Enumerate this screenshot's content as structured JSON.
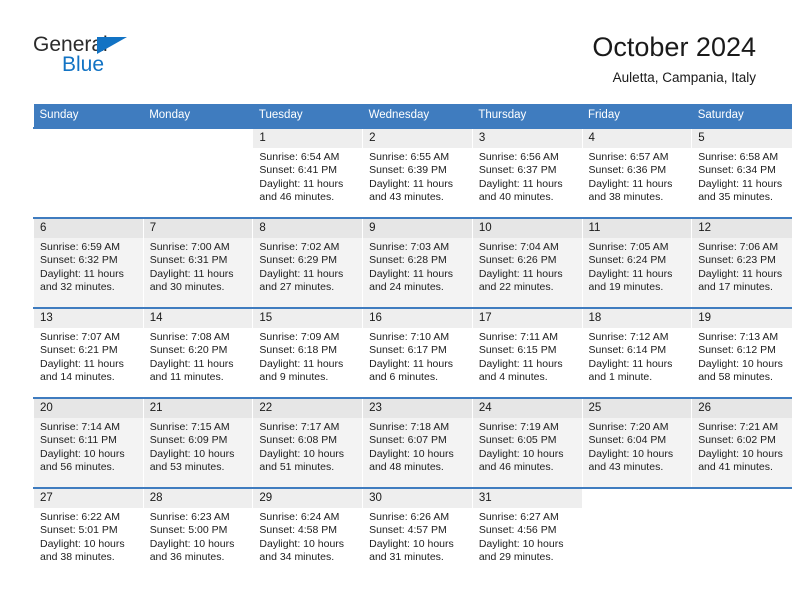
{
  "brand": {
    "name_part1": "General",
    "name_part2": "Blue",
    "accent_color": "#1273c4",
    "triangle_icon": "triangle-icon"
  },
  "header": {
    "title": "October 2024",
    "subtitle": "Auletta, Campania, Italy"
  },
  "calendar": {
    "header_bg": "#3f7cbf",
    "weekdays": [
      "Sunday",
      "Monday",
      "Tuesday",
      "Wednesday",
      "Thursday",
      "Friday",
      "Saturday"
    ],
    "labels": {
      "sunrise": "Sunrise:",
      "sunset": "Sunset:",
      "daylight": "Daylight:"
    },
    "weeks": [
      [
        {
          "day": "",
          "empty": true
        },
        {
          "day": "",
          "empty": true
        },
        {
          "day": "1",
          "sunrise": "Sunrise: 6:54 AM",
          "sunset": "Sunset: 6:41 PM",
          "daylight1": "Daylight: 11 hours",
          "daylight2": "and 46 minutes."
        },
        {
          "day": "2",
          "sunrise": "Sunrise: 6:55 AM",
          "sunset": "Sunset: 6:39 PM",
          "daylight1": "Daylight: 11 hours",
          "daylight2": "and 43 minutes."
        },
        {
          "day": "3",
          "sunrise": "Sunrise: 6:56 AM",
          "sunset": "Sunset: 6:37 PM",
          "daylight1": "Daylight: 11 hours",
          "daylight2": "and 40 minutes."
        },
        {
          "day": "4",
          "sunrise": "Sunrise: 6:57 AM",
          "sunset": "Sunset: 6:36 PM",
          "daylight1": "Daylight: 11 hours",
          "daylight2": "and 38 minutes."
        },
        {
          "day": "5",
          "sunrise": "Sunrise: 6:58 AM",
          "sunset": "Sunset: 6:34 PM",
          "daylight1": "Daylight: 11 hours",
          "daylight2": "and 35 minutes."
        }
      ],
      [
        {
          "day": "6",
          "sunrise": "Sunrise: 6:59 AM",
          "sunset": "Sunset: 6:32 PM",
          "daylight1": "Daylight: 11 hours",
          "daylight2": "and 32 minutes."
        },
        {
          "day": "7",
          "sunrise": "Sunrise: 7:00 AM",
          "sunset": "Sunset: 6:31 PM",
          "daylight1": "Daylight: 11 hours",
          "daylight2": "and 30 minutes."
        },
        {
          "day": "8",
          "sunrise": "Sunrise: 7:02 AM",
          "sunset": "Sunset: 6:29 PM",
          "daylight1": "Daylight: 11 hours",
          "daylight2": "and 27 minutes."
        },
        {
          "day": "9",
          "sunrise": "Sunrise: 7:03 AM",
          "sunset": "Sunset: 6:28 PM",
          "daylight1": "Daylight: 11 hours",
          "daylight2": "and 24 minutes."
        },
        {
          "day": "10",
          "sunrise": "Sunrise: 7:04 AM",
          "sunset": "Sunset: 6:26 PM",
          "daylight1": "Daylight: 11 hours",
          "daylight2": "and 22 minutes."
        },
        {
          "day": "11",
          "sunrise": "Sunrise: 7:05 AM",
          "sunset": "Sunset: 6:24 PM",
          "daylight1": "Daylight: 11 hours",
          "daylight2": "and 19 minutes."
        },
        {
          "day": "12",
          "sunrise": "Sunrise: 7:06 AM",
          "sunset": "Sunset: 6:23 PM",
          "daylight1": "Daylight: 11 hours",
          "daylight2": "and 17 minutes."
        }
      ],
      [
        {
          "day": "13",
          "sunrise": "Sunrise: 7:07 AM",
          "sunset": "Sunset: 6:21 PM",
          "daylight1": "Daylight: 11 hours",
          "daylight2": "and 14 minutes."
        },
        {
          "day": "14",
          "sunrise": "Sunrise: 7:08 AM",
          "sunset": "Sunset: 6:20 PM",
          "daylight1": "Daylight: 11 hours",
          "daylight2": "and 11 minutes."
        },
        {
          "day": "15",
          "sunrise": "Sunrise: 7:09 AM",
          "sunset": "Sunset: 6:18 PM",
          "daylight1": "Daylight: 11 hours",
          "daylight2": "and 9 minutes."
        },
        {
          "day": "16",
          "sunrise": "Sunrise: 7:10 AM",
          "sunset": "Sunset: 6:17 PM",
          "daylight1": "Daylight: 11 hours",
          "daylight2": "and 6 minutes."
        },
        {
          "day": "17",
          "sunrise": "Sunrise: 7:11 AM",
          "sunset": "Sunset: 6:15 PM",
          "daylight1": "Daylight: 11 hours",
          "daylight2": "and 4 minutes."
        },
        {
          "day": "18",
          "sunrise": "Sunrise: 7:12 AM",
          "sunset": "Sunset: 6:14 PM",
          "daylight1": "Daylight: 11 hours",
          "daylight2": "and 1 minute."
        },
        {
          "day": "19",
          "sunrise": "Sunrise: 7:13 AM",
          "sunset": "Sunset: 6:12 PM",
          "daylight1": "Daylight: 10 hours",
          "daylight2": "and 58 minutes."
        }
      ],
      [
        {
          "day": "20",
          "sunrise": "Sunrise: 7:14 AM",
          "sunset": "Sunset: 6:11 PM",
          "daylight1": "Daylight: 10 hours",
          "daylight2": "and 56 minutes."
        },
        {
          "day": "21",
          "sunrise": "Sunrise: 7:15 AM",
          "sunset": "Sunset: 6:09 PM",
          "daylight1": "Daylight: 10 hours",
          "daylight2": "and 53 minutes."
        },
        {
          "day": "22",
          "sunrise": "Sunrise: 7:17 AM",
          "sunset": "Sunset: 6:08 PM",
          "daylight1": "Daylight: 10 hours",
          "daylight2": "and 51 minutes."
        },
        {
          "day": "23",
          "sunrise": "Sunrise: 7:18 AM",
          "sunset": "Sunset: 6:07 PM",
          "daylight1": "Daylight: 10 hours",
          "daylight2": "and 48 minutes."
        },
        {
          "day": "24",
          "sunrise": "Sunrise: 7:19 AM",
          "sunset": "Sunset: 6:05 PM",
          "daylight1": "Daylight: 10 hours",
          "daylight2": "and 46 minutes."
        },
        {
          "day": "25",
          "sunrise": "Sunrise: 7:20 AM",
          "sunset": "Sunset: 6:04 PM",
          "daylight1": "Daylight: 10 hours",
          "daylight2": "and 43 minutes."
        },
        {
          "day": "26",
          "sunrise": "Sunrise: 7:21 AM",
          "sunset": "Sunset: 6:02 PM",
          "daylight1": "Daylight: 10 hours",
          "daylight2": "and 41 minutes."
        }
      ],
      [
        {
          "day": "27",
          "sunrise": "Sunrise: 6:22 AM",
          "sunset": "Sunset: 5:01 PM",
          "daylight1": "Daylight: 10 hours",
          "daylight2": "and 38 minutes."
        },
        {
          "day": "28",
          "sunrise": "Sunrise: 6:23 AM",
          "sunset": "Sunset: 5:00 PM",
          "daylight1": "Daylight: 10 hours",
          "daylight2": "and 36 minutes."
        },
        {
          "day": "29",
          "sunrise": "Sunrise: 6:24 AM",
          "sunset": "Sunset: 4:58 PM",
          "daylight1": "Daylight: 10 hours",
          "daylight2": "and 34 minutes."
        },
        {
          "day": "30",
          "sunrise": "Sunrise: 6:26 AM",
          "sunset": "Sunset: 4:57 PM",
          "daylight1": "Daylight: 10 hours",
          "daylight2": "and 31 minutes."
        },
        {
          "day": "31",
          "sunrise": "Sunrise: 6:27 AM",
          "sunset": "Sunset: 4:56 PM",
          "daylight1": "Daylight: 10 hours",
          "daylight2": "and 29 minutes."
        },
        {
          "day": "",
          "empty": true
        },
        {
          "day": "",
          "empty": true
        }
      ]
    ]
  }
}
